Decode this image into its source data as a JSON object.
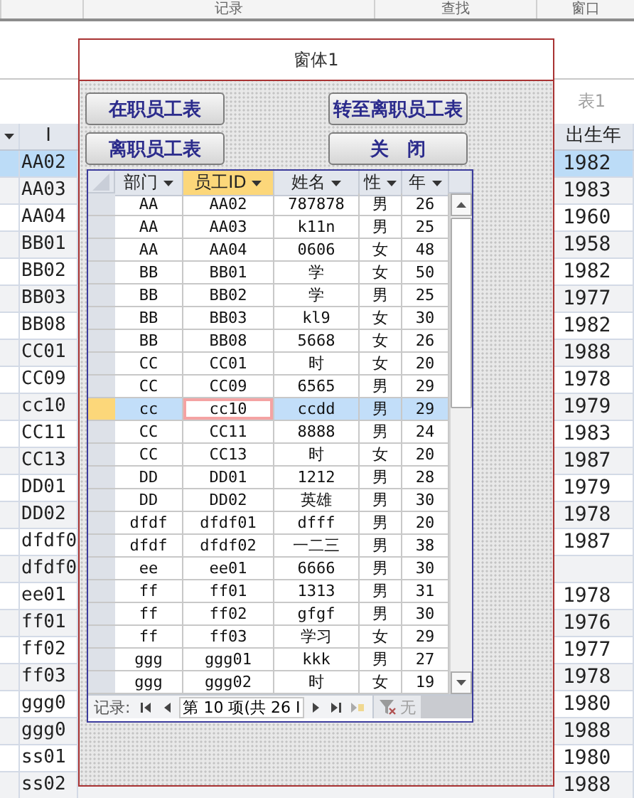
{
  "ribbon": {
    "groups": [
      "记录",
      "查找",
      "窗口"
    ]
  },
  "document_tab": {
    "label": "表1"
  },
  "table": {
    "columns": [
      "I",
      "出生年"
    ],
    "rows": [
      {
        "id": "AA02",
        "birth_year": "1982",
        "selected": true
      },
      {
        "id": "AA03",
        "birth_year": "1983",
        "selected": false
      },
      {
        "id": "AA04",
        "birth_year": "1960",
        "selected": false
      },
      {
        "id": "BB01",
        "birth_year": "1958",
        "selected": false
      },
      {
        "id": "BB02",
        "birth_year": "1982",
        "selected": false
      },
      {
        "id": "BB03",
        "birth_year": "1977",
        "selected": false
      },
      {
        "id": "BB08",
        "birth_year": "1982",
        "selected": false
      },
      {
        "id": "CC01",
        "birth_year": "1988",
        "selected": false
      },
      {
        "id": "CC09",
        "birth_year": "1978",
        "selected": false
      },
      {
        "id": "cc10",
        "birth_year": "1979",
        "selected": false
      },
      {
        "id": "CC11",
        "birth_year": "1983",
        "selected": false
      },
      {
        "id": "CC13",
        "birth_year": "1987",
        "selected": false
      },
      {
        "id": "DD01",
        "birth_year": "1979",
        "selected": false
      },
      {
        "id": "DD02",
        "birth_year": "1978",
        "selected": false
      },
      {
        "id": "dfdf0",
        "birth_year": "1987",
        "selected": false
      },
      {
        "id": "dfdf0",
        "selected": false
      },
      {
        "id": "ee01",
        "birth_year": "1978",
        "selected": false
      },
      {
        "id": "ff01",
        "birth_year": "1976",
        "selected": false
      },
      {
        "id": "ff02",
        "birth_year": "1977",
        "selected": false
      },
      {
        "id": "ff03",
        "birth_year": "1978",
        "selected": false
      },
      {
        "id": "ggg0",
        "birth_year": "1980",
        "selected": false
      },
      {
        "id": "ggg0",
        "birth_year": "1988",
        "selected": false
      },
      {
        "id": "ss01",
        "birth_year": "1980",
        "selected": false
      },
      {
        "id": "ss02",
        "birth_year": "1988",
        "selected": false
      }
    ]
  },
  "form": {
    "title": "窗体1",
    "buttons": [
      "在职员工表",
      "转至离职员工表",
      "离职员工表",
      "关　闭"
    ],
    "subform": {
      "columns": [
        {
          "label": "部门",
          "active": false
        },
        {
          "label": "员工ID",
          "active": true
        },
        {
          "label": "姓名",
          "active": false
        },
        {
          "label": "性",
          "active": false
        },
        {
          "label": "年",
          "active": false
        }
      ],
      "rows": [
        {
          "cells": [
            "AA",
            "AA02",
            "787878",
            "男",
            "26"
          ],
          "selected": false
        },
        {
          "cells": [
            "AA",
            "AA03",
            "k11n",
            "男",
            "25"
          ],
          "selected": false
        },
        {
          "cells": [
            "AA",
            "AA04",
            "0606",
            "女",
            "48"
          ],
          "selected": false
        },
        {
          "cells": [
            "BB",
            "BB01",
            "学",
            "女",
            "50"
          ],
          "selected": false
        },
        {
          "cells": [
            "BB",
            "BB02",
            "学",
            "男",
            "25"
          ],
          "selected": false
        },
        {
          "cells": [
            "BB",
            "BB03",
            "kl9",
            "女",
            "30"
          ],
          "selected": false
        },
        {
          "cells": [
            "BB",
            "BB08",
            "5668",
            "女",
            "26"
          ],
          "selected": false
        },
        {
          "cells": [
            "CC",
            "CC01",
            "时",
            "女",
            "20"
          ],
          "selected": false
        },
        {
          "cells": [
            "CC",
            "CC09",
            "6565",
            "男",
            "29"
          ],
          "selected": false
        },
        {
          "cells": [
            "cc",
            "cc10",
            "ccdd",
            "男",
            "29"
          ],
          "selected": true
        },
        {
          "cells": [
            "CC",
            "CC11",
            "8888",
            "男",
            "24"
          ],
          "selected": false
        },
        {
          "cells": [
            "CC",
            "CC13",
            "时",
            "女",
            "20"
          ],
          "selected": false
        },
        {
          "cells": [
            "DD",
            "DD01",
            "1212",
            "男",
            "28"
          ],
          "selected": false
        },
        {
          "cells": [
            "DD",
            "DD02",
            "英雄",
            "男",
            "30"
          ],
          "selected": false
        },
        {
          "cells": [
            "dfdf",
            "dfdf01",
            "dfff",
            "男",
            "20"
          ],
          "selected": false
        },
        {
          "cells": [
            "dfdf",
            "dfdf02",
            "一二三",
            "男",
            "38"
          ],
          "selected": false
        },
        {
          "cells": [
            "ee",
            "ee01",
            "6666",
            "男",
            "30"
          ],
          "selected": false
        },
        {
          "cells": [
            "ff",
            "ff01",
            "1313",
            "男",
            "31"
          ],
          "selected": false
        },
        {
          "cells": [
            "ff",
            "ff02",
            "gfgf",
            "男",
            "30"
          ],
          "selected": false
        },
        {
          "cells": [
            "ff",
            "ff03",
            "学习",
            "女",
            "29"
          ],
          "selected": false
        },
        {
          "cells": [
            "ggg",
            "ggg01",
            "kkk",
            "男",
            "27"
          ],
          "selected": false
        },
        {
          "cells": [
            "ggg",
            "ggg02",
            "时",
            "女",
            "19"
          ],
          "selected": false
        }
      ],
      "navigation": {
        "label": "记录:",
        "position": "第 10 项(共 26 I",
        "filter": {
          "label": "无",
          "disabled": true
        }
      }
    }
  }
}
